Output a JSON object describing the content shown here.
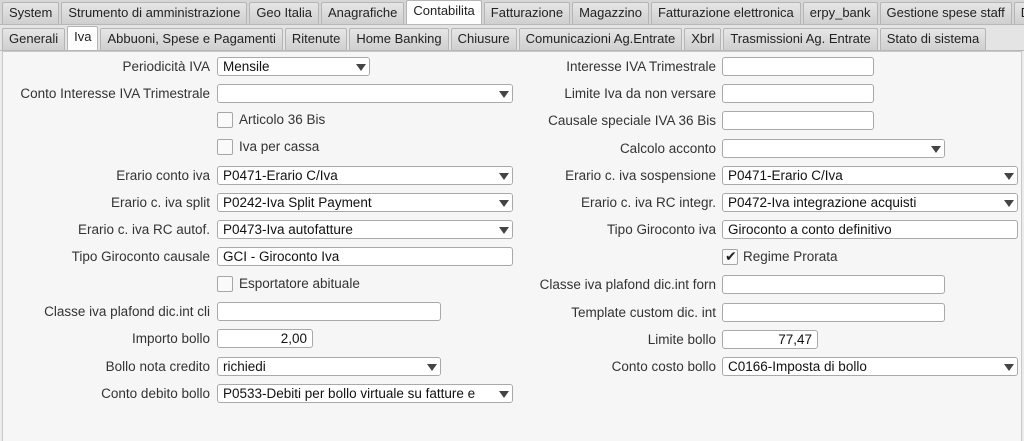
{
  "top_tabs": [
    "System",
    "Strumento di amministrazione",
    "Geo Italia",
    "Anagrafiche",
    "Contabilita",
    "Fatturazione",
    "Magazzino",
    "Fatturazione elettronica",
    "erpy_bank",
    "Gestione spese staff",
    "D"
  ],
  "sub_tabs": [
    "Generali",
    "Iva",
    "Abbuoni, Spese e Pagamenti",
    "Ritenute",
    "Home Banking",
    "Chiusure",
    "Comunicazioni Ag.Entrate",
    "Xbrl",
    "Trasmissioni Ag. Entrate",
    "Stato di sistema"
  ],
  "left": {
    "periodicita_iva": {
      "label": "Periodicità IVA",
      "value": "Mensile"
    },
    "conto_interessi": {
      "label": "Conto Interesse IVA Trimestrale",
      "value": ""
    },
    "articolo_36_bis": {
      "label": "Articolo 36 Bis"
    },
    "iva_per_cassa": {
      "label": "Iva per cassa"
    },
    "erario_conto_iva": {
      "label": "Erario conto iva",
      "value": "P0471-Erario C/Iva"
    },
    "erario_iva_split": {
      "label": "Erario c. iva split",
      "value": "P0242-Iva Split Payment"
    },
    "erario_iva_rc_autof": {
      "label": "Erario c. iva RC autof.",
      "value": "P0473-Iva autofatture"
    },
    "tipo_giroconto_causale": {
      "label": "Tipo Giroconto causale",
      "value": "GCI - Giroconto Iva"
    },
    "esportatore_abituale": {
      "label": "Esportatore abituale"
    },
    "classe_plafond_cli": {
      "label": "Classe iva plafond dic.int cli",
      "value": ""
    },
    "importo_bollo": {
      "label": "Importo bollo",
      "value": "2,00"
    },
    "bollo_nota_credito": {
      "label": "Bollo nota credito",
      "value": "richiedi"
    },
    "conto_debito_bollo": {
      "label": "Conto debito bollo",
      "value": "P0533-Debiti per bollo virtuale su fatture e"
    }
  },
  "right": {
    "interesse_iva_trim": {
      "label": "Interesse IVA Trimestrale",
      "value": ""
    },
    "limite_iva": {
      "label": "Limite Iva da non versare",
      "value": ""
    },
    "causale_36_bis": {
      "label": "Causale speciale IVA 36 Bis",
      "value": ""
    },
    "calcolo_acconto": {
      "label": "Calcolo acconto",
      "value": ""
    },
    "erario_iva_sospensione": {
      "label": "Erario c. iva sospensione",
      "value": "P0471-Erario C/Iva"
    },
    "erario_iva_rc_integr": {
      "label": "Erario c. iva RC integr.",
      "value": "P0472-Iva integrazione acquisti"
    },
    "tipo_giroconto_iva": {
      "label": "Tipo Giroconto iva",
      "value": "Giroconto a conto definitivo"
    },
    "regime_prorata": {
      "label": "Regime Prorata",
      "checked": true
    },
    "classe_plafond_forn": {
      "label": "Classe iva plafond dic.int forn",
      "value": ""
    },
    "template_custom": {
      "label": "Template custom dic. int",
      "value": ""
    },
    "limite_bollo": {
      "label": "Limite bollo",
      "value": "77,47"
    },
    "conto_costo_bollo": {
      "label": "Conto costo bollo",
      "value": "C0166-Imposta di bollo"
    }
  }
}
